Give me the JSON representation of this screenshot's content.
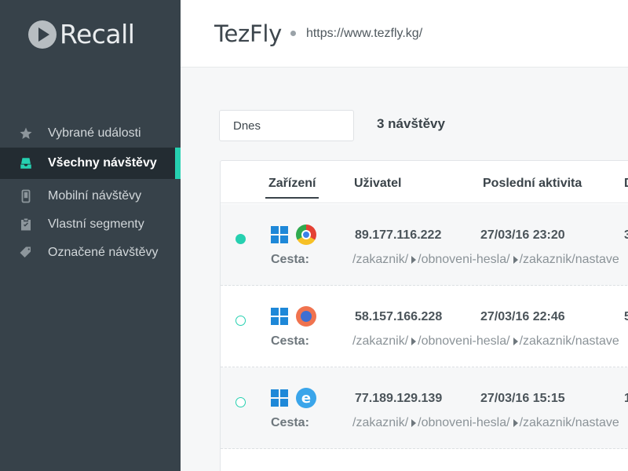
{
  "app": {
    "name": "Recall"
  },
  "sidebar": {
    "items": [
      {
        "label": "Vybrané události",
        "icon": "star-icon"
      },
      {
        "label": "Všechny návštěvy",
        "icon": "tray-icon",
        "active": true
      },
      {
        "label": "Mobilní návštěvy",
        "icon": "mobile-icon"
      },
      {
        "label": "Vlastní segmenty",
        "icon": "clipboard-check-icon"
      },
      {
        "label": "Označené návštěvy",
        "icon": "tag-icon"
      }
    ]
  },
  "header": {
    "site_name": "TezFly",
    "site_url": "https://www.tezfly.kg/"
  },
  "filter": {
    "date_value": "Dnes",
    "visit_count": "3 návštěvy"
  },
  "table": {
    "columns": [
      "Zařízení",
      "Uživatel",
      "Poslední aktivita",
      "D"
    ],
    "active_column": "Zařízení",
    "path_label": "Cesta:",
    "rows": [
      {
        "online": true,
        "os": "windows-icon",
        "browser": "chrome-icon",
        "ip": "89.177.116.222",
        "last_activity": "27/03/16 23:20",
        "truncated": "3",
        "path": [
          "/zakaznik/",
          "/obnoveni-hesla/",
          "/zakaznik/nastave"
        ]
      },
      {
        "online": false,
        "os": "windows-icon",
        "browser": "firefox-icon",
        "ip": "58.157.166.228",
        "last_activity": "27/03/16 22:46",
        "truncated": "5",
        "path": [
          "/zakaznik/",
          "/obnoveni-hesla/",
          "/zakaznik/nastave"
        ]
      },
      {
        "online": false,
        "os": "windows-icon",
        "browser": "ie-icon",
        "ip": "77.189.129.139",
        "last_activity": "27/03/16 15:15",
        "truncated": "1",
        "path": [
          "/zakaznik/",
          "/obnoveni-hesla/",
          "/zakaznik/nastave"
        ]
      }
    ]
  },
  "colors": {
    "sidebar": "#37424a",
    "accent": "#26d0b0",
    "windows": "#1e88d8"
  }
}
